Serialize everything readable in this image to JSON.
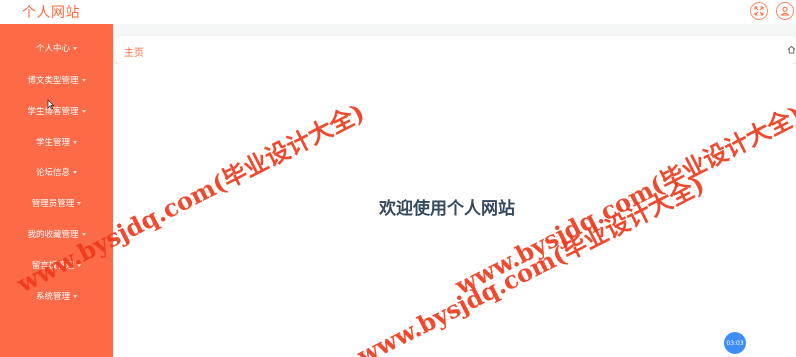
{
  "header": {
    "site_title": "个人网站",
    "icons": [
      "fullscreen-icon",
      "user-icon"
    ]
  },
  "sidebar": {
    "items": [
      {
        "label": "个人中心"
      },
      {
        "label": "博文类型管理"
      },
      {
        "label": "学生博客管理"
      },
      {
        "label": "学生管理"
      },
      {
        "label": "论坛信息"
      },
      {
        "label": "管理员管理"
      },
      {
        "label": "我的收藏管理"
      },
      {
        "label": "留言板管理"
      },
      {
        "label": "系统管理"
      }
    ]
  },
  "breadcrumb": {
    "label": "主页",
    "icon": "home-icon"
  },
  "main": {
    "welcome": "欢迎使用个人网站"
  },
  "timer": {
    "text": "03:03"
  },
  "watermarks": [
    "www.bysjdq.com(毕业设计大全)",
    "www.bysjdq.com(毕业设计大全)",
    "www.bysjdq.com(毕业设计大全)"
  ],
  "colors": {
    "accent": "#ff6a3d",
    "sidebar_bg": "#fd6a47",
    "welcome_text": "#34495e",
    "watermark": "#f03a1c",
    "timer_bg": "#3f8ef5"
  }
}
